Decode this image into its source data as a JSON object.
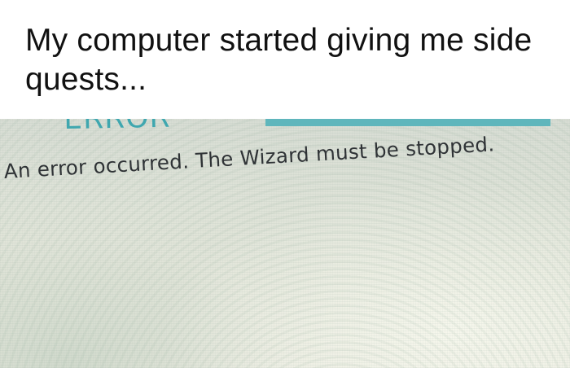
{
  "caption": {
    "text": "My computer started giving me side quests..."
  },
  "dialog": {
    "heading": "ERROR",
    "message": "An error occurred. The Wizard must be stopped.",
    "accent_color": "#5fb6bc",
    "heading_color": "#3fa7af"
  }
}
